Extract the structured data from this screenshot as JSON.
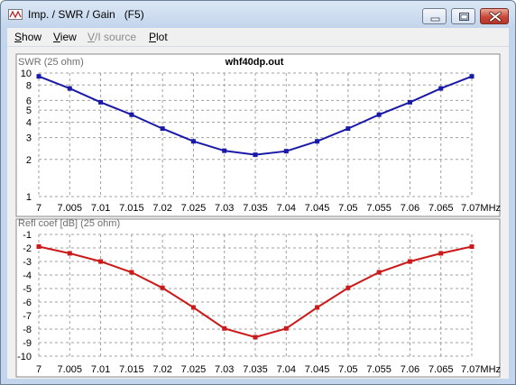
{
  "window": {
    "title": "Imp. / SWR / Gain   (F5)"
  },
  "icons": {
    "app": "antenna-app-icon",
    "minimize": "minimize-icon",
    "maximize": "maximize-icon",
    "close": "close-icon"
  },
  "colors": {
    "swr_series": "#1a1aa8",
    "refl_series": "#cc1a1a",
    "grid": "#a0a0a0",
    "axis_label": "#6e6e6e"
  },
  "menu": [
    {
      "label": "Show",
      "underline": "S",
      "enabled": true
    },
    {
      "label": "View",
      "underline": "V",
      "enabled": true
    },
    {
      "label": "V/I source",
      "underline": "V",
      "enabled": false
    },
    {
      "label": "Plot",
      "underline": "P",
      "enabled": true
    }
  ],
  "plot_title": "whf40dp.out",
  "chart_data": [
    {
      "type": "line",
      "ylabel": "SWR (25 ohm)",
      "yscale": "log",
      "ylim": [
        1,
        10
      ],
      "y_ticks": [
        1,
        2,
        3,
        4,
        5,
        6,
        8,
        10
      ],
      "x": [
        7.0,
        7.005,
        7.01,
        7.015,
        7.02,
        7.025,
        7.03,
        7.035,
        7.04,
        7.045,
        7.05,
        7.055,
        7.06,
        7.065,
        7.07
      ],
      "x_ticks": [
        "7",
        "7.005",
        "7.01",
        "7.015",
        "7.02",
        "7.025",
        "7.03",
        "7.035",
        "7.04",
        "7.045",
        "7.05",
        "7.055",
        "7.06",
        "7.065",
        "7.07"
      ],
      "x_unit": "MHz",
      "xlim": [
        7.0,
        7.07
      ],
      "grid": true,
      "series": [
        {
          "values": [
            9.4,
            7.5,
            5.8,
            4.6,
            3.55,
            2.8,
            2.35,
            2.18,
            2.33,
            2.8,
            3.55,
            4.6,
            5.8,
            7.5,
            9.4
          ]
        }
      ]
    },
    {
      "type": "line",
      "ylabel": "Refl coef [dB] (25 ohm)",
      "ylim": [
        -10,
        -1
      ],
      "y_ticks": [
        -1,
        -2,
        -3,
        -4,
        -5,
        -6,
        -7,
        -8,
        -9,
        -10
      ],
      "x": [
        7.0,
        7.005,
        7.01,
        7.015,
        7.02,
        7.025,
        7.03,
        7.035,
        7.04,
        7.045,
        7.05,
        7.055,
        7.06,
        7.065,
        7.07
      ],
      "x_ticks": [
        "7",
        "7.005",
        "7.01",
        "7.015",
        "7.02",
        "7.025",
        "7.03",
        "7.035",
        "7.04",
        "7.045",
        "7.05",
        "7.055",
        "7.06",
        "7.065",
        "7.07"
      ],
      "x_unit": "MHz",
      "xlim": [
        7.0,
        7.07
      ],
      "grid": true,
      "series": [
        {
          "values": [
            -1.9,
            -2.4,
            -3.0,
            -3.8,
            -4.95,
            -6.4,
            -7.95,
            -8.6,
            -7.95,
            -6.4,
            -4.95,
            -3.8,
            -3.0,
            -2.4,
            -1.9
          ]
        }
      ]
    }
  ]
}
